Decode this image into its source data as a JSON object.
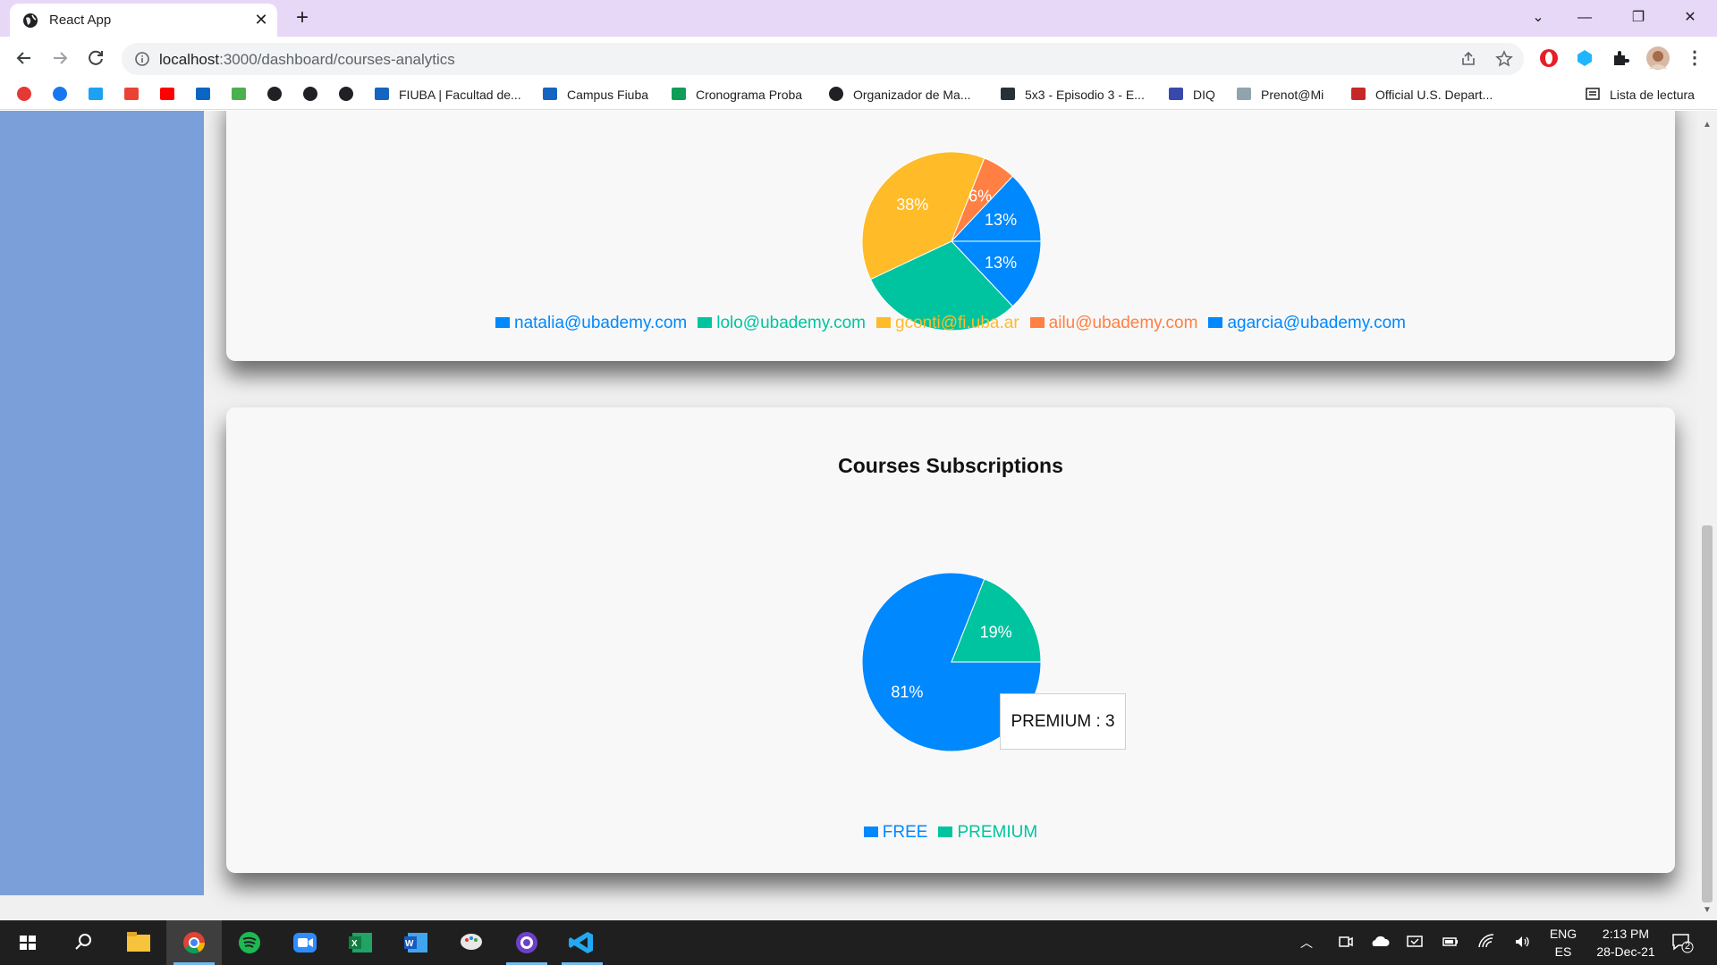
{
  "browser": {
    "tab_title": "React App",
    "tab_close": "✕",
    "new_tab": "+",
    "url_host": "localhost",
    "url_rest": ":3000/dashboard/courses-analytics",
    "window_controls": {
      "dropdown": "⌄",
      "minimize": "—",
      "restore": "❐",
      "close": "✕"
    }
  },
  "bookmarks": [
    {
      "label": "",
      "icon": "opera-alert-icon"
    },
    {
      "label": "",
      "icon": "facebook-icon"
    },
    {
      "label": "",
      "icon": "twitter-icon"
    },
    {
      "label": "",
      "icon": "gmail-icon"
    },
    {
      "label": "",
      "icon": "youtube-icon"
    },
    {
      "label": "",
      "icon": "linkedin-icon"
    },
    {
      "label": "",
      "icon": "tool-icon"
    },
    {
      "label": "",
      "icon": "globe-icon"
    },
    {
      "label": "",
      "icon": "github-icon"
    },
    {
      "label": "",
      "icon": "github-icon"
    },
    {
      "label": "FIUBA | Facultad de...",
      "icon": "fiuba-icon"
    },
    {
      "label": "Campus Fiuba",
      "icon": "fiuba-icon"
    },
    {
      "label": "Cronograma Proba",
      "icon": "sheets-icon"
    },
    {
      "label": "Organizador de Ma...",
      "icon": "globe-icon"
    },
    {
      "label": "5x3 - Episodio 3 - E...",
      "icon": "terminal-icon"
    },
    {
      "label": "DIQ",
      "icon": "diq-icon"
    },
    {
      "label": "Prenot@Mi",
      "icon": "document-icon"
    },
    {
      "label": "Official U.S. Depart...",
      "icon": "flag-icon"
    }
  ],
  "reading_list": "Lista de lectura",
  "charts": {
    "top_legend": [
      {
        "label": "natalia@ubademy.com",
        "color": "#0088fe"
      },
      {
        "label": "lolo@ubademy.com",
        "color": "#00c49f"
      },
      {
        "label": "gconti@fi.uba.ar",
        "color": "#ffbb28"
      },
      {
        "label": "ailu@ubademy.com",
        "color": "#ff8042"
      },
      {
        "label": "agarcia@ubademy.com",
        "color": "#0088fe"
      }
    ],
    "subscriptions": {
      "title": "Courses Subscriptions",
      "tooltip": "PREMIUM : 3",
      "legend": [
        {
          "label": "FREE",
          "color": "#0088fe"
        },
        {
          "label": "PREMIUM",
          "color": "#00c49f"
        }
      ]
    }
  },
  "chart_data": [
    {
      "type": "pie",
      "title": "",
      "labels": [
        "natalia@ubademy.com",
        "lolo@ubademy.com",
        "gconti@fi.uba.ar",
        "ailu@ubademy.com",
        "agarcia@ubademy.com"
      ],
      "values": [
        13,
        30,
        38,
        6,
        13
      ],
      "visible_percent_labels": [
        "13%",
        "13%",
        "6%",
        "38%"
      ],
      "colors": [
        "#0088fe",
        "#00c49f",
        "#ffbb28",
        "#ff8042",
        "#0088fe"
      ],
      "legend": "bottom"
    },
    {
      "type": "pie",
      "title": "Courses Subscriptions",
      "labels": [
        "FREE",
        "PREMIUM"
      ],
      "values": [
        81,
        19
      ],
      "percent_labels": [
        "81%",
        "19%"
      ],
      "colors": [
        "#0088fe",
        "#00c49f"
      ],
      "legend": "bottom"
    }
  ],
  "taskbar": {
    "lang_top": "ENG",
    "lang_bottom": "ES",
    "time": "2:13 PM",
    "date": "28-Dec-21",
    "notification_count": "2",
    "apps": [
      "start-icon",
      "search-icon",
      "file-explorer-icon",
      "chrome-icon",
      "spotify-icon",
      "zoom-icon",
      "excel-icon",
      "word-icon",
      "paint-icon",
      "github-desktop-icon",
      "vscode-icon"
    ]
  }
}
